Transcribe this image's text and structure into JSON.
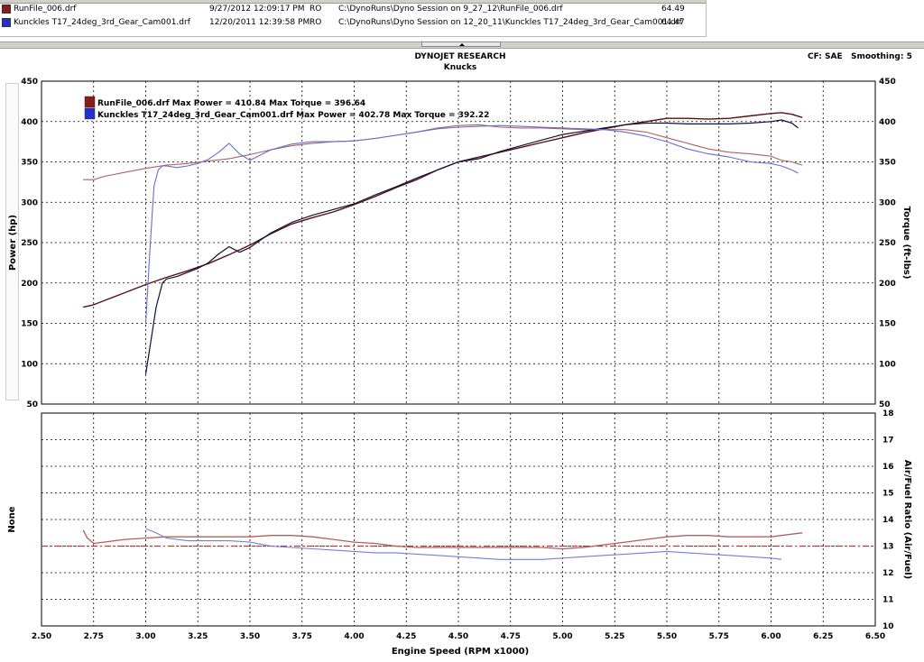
{
  "files": [
    {
      "name": "RunFile_006.drf",
      "date": "9/27/2012 12:09:17 PM",
      "type": "RO",
      "path": "C:\\DynoRuns\\Dyno Session on 9_27_12\\RunFile_006.drf",
      "value": "64.49",
      "color": "#8b1a1a"
    },
    {
      "name": "Kunckles T17_24deg_3rd_Gear_Cam001.drf",
      "date": "12/20/2011 12:39:58 PM",
      "type": "RO",
      "path": "C:\\DynoRuns\\Dyno Session on 12_20_11\\Kunckles T17_24deg_3rd_Gear_Cam001.drf",
      "value": "64.47",
      "color": "#2233cc"
    }
  ],
  "header": {
    "brand": "DYNOJET RESEARCH",
    "subtitle": "Knucks",
    "cf": "CF: SAE",
    "smoothing": "Smoothing: 5"
  },
  "chart_data": [
    {
      "type": "line",
      "title": "DYNOJET RESEARCH",
      "subtitle": "Knucks",
      "xlabel": "Engine Speed (RPM x1000)",
      "ylabel": "Power (hp)",
      "y2label": "Torque (ft-lbs)",
      "xlim": [
        2.5,
        6.5
      ],
      "ylim": [
        50,
        450
      ],
      "y2lim": [
        50,
        450
      ],
      "xticks": [
        "2.50",
        "2.75",
        "3.00",
        "3.25",
        "3.50",
        "3.75",
        "4.00",
        "4.25",
        "4.50",
        "4.75",
        "5.00",
        "5.25",
        "5.50",
        "5.75",
        "6.00",
        "6.25",
        "6.50"
      ],
      "yticks": [
        "50",
        "100",
        "150",
        "200",
        "250",
        "300",
        "350",
        "400",
        "450"
      ],
      "grid": true,
      "legend_position": "top-left",
      "legend": [
        {
          "text": "RunFile_006.drf Max Power = 410.84 Max Torque = 396.64",
          "color": "#8b1a1a"
        },
        {
          "text": "Kunckles T17_24deg_3rd_Gear_Cam001.drf Max Power = 402.78 Max Torque = 392.22",
          "color": "#2233cc"
        }
      ],
      "series": [
        {
          "name": "RunFile_006.drf Power",
          "axis": "left",
          "color": "#5a1010",
          "width": 1.4,
          "x": [
            2.7,
            2.75,
            2.8,
            2.9,
            3.0,
            3.1,
            3.2,
            3.3,
            3.4,
            3.5,
            3.6,
            3.7,
            3.8,
            3.9,
            4.0,
            4.1,
            4.2,
            4.3,
            4.4,
            4.5,
            4.6,
            4.7,
            4.8,
            4.9,
            5.0,
            5.1,
            5.2,
            5.3,
            5.4,
            5.5,
            5.6,
            5.7,
            5.8,
            5.9,
            6.0,
            6.05,
            6.1,
            6.15
          ],
          "y": [
            170,
            173,
            178,
            188,
            198,
            207,
            215,
            224,
            235,
            247,
            261,
            273,
            281,
            288,
            297,
            307,
            318,
            328,
            340,
            350,
            356,
            362,
            368,
            374,
            380,
            386,
            391,
            396,
            400,
            404,
            404,
            403,
            404,
            407,
            410,
            411,
            409,
            405
          ]
        },
        {
          "name": "RunFile_006.drf Torque",
          "axis": "right",
          "color": "#b06060",
          "width": 1.1,
          "x": [
            2.7,
            2.75,
            2.8,
            2.9,
            3.0,
            3.1,
            3.2,
            3.3,
            3.4,
            3.5,
            3.6,
            3.7,
            3.8,
            3.9,
            4.0,
            4.1,
            4.2,
            4.3,
            4.4,
            4.5,
            4.6,
            4.7,
            4.8,
            4.9,
            5.0,
            5.1,
            5.2,
            5.3,
            5.4,
            5.5,
            5.6,
            5.7,
            5.8,
            5.9,
            6.0,
            6.05,
            6.1,
            6.15
          ],
          "y": [
            328,
            328,
            332,
            337,
            342,
            346,
            348,
            351,
            354,
            359,
            365,
            370,
            373,
            375,
            376,
            379,
            383,
            387,
            392,
            395,
            396,
            393,
            392,
            392,
            391,
            390,
            390,
            390,
            387,
            380,
            373,
            366,
            362,
            360,
            357,
            352,
            350,
            346
          ]
        },
        {
          "name": "Kunckles Power",
          "axis": "left",
          "color": "#101040",
          "width": 1.2,
          "x": [
            3.0,
            3.02,
            3.05,
            3.08,
            3.1,
            3.15,
            3.2,
            3.25,
            3.3,
            3.35,
            3.4,
            3.45,
            3.5,
            3.6,
            3.7,
            3.8,
            3.9,
            4.0,
            4.1,
            4.2,
            4.3,
            4.4,
            4.5,
            4.6,
            4.7,
            4.8,
            4.9,
            5.0,
            5.1,
            5.2,
            5.3,
            5.4,
            5.5,
            5.6,
            5.7,
            5.8,
            5.9,
            6.0,
            6.05,
            6.1,
            6.13
          ],
          "y": [
            87,
            120,
            170,
            200,
            205,
            208,
            213,
            218,
            225,
            236,
            245,
            238,
            244,
            262,
            275,
            284,
            291,
            298,
            309,
            319,
            330,
            340,
            350,
            354,
            363,
            370,
            377,
            384,
            388,
            392,
            396,
            398,
            398,
            397,
            397,
            397,
            398,
            400,
            402,
            398,
            392
          ]
        },
        {
          "name": "Kunckles Torque",
          "axis": "right",
          "color": "#6070d0",
          "width": 1.1,
          "x": [
            3.0,
            3.02,
            3.04,
            3.06,
            3.08,
            3.1,
            3.15,
            3.2,
            3.25,
            3.3,
            3.35,
            3.4,
            3.45,
            3.5,
            3.6,
            3.7,
            3.8,
            3.9,
            4.0,
            4.1,
            4.2,
            4.3,
            4.4,
            4.5,
            4.6,
            4.7,
            4.8,
            4.9,
            5.0,
            5.1,
            5.2,
            5.3,
            5.4,
            5.5,
            5.6,
            5.7,
            5.8,
            5.9,
            6.0,
            6.05,
            6.1,
            6.13
          ],
          "y": [
            150,
            240,
            320,
            340,
            345,
            345,
            343,
            345,
            348,
            353,
            362,
            373,
            360,
            352,
            365,
            372,
            375,
            375,
            376,
            379,
            383,
            387,
            391,
            393,
            394,
            395,
            394,
            393,
            392,
            391,
            390,
            387,
            382,
            375,
            366,
            360,
            356,
            350,
            348,
            345,
            340,
            336
          ]
        }
      ]
    },
    {
      "type": "line",
      "xlabel": "Engine Speed (RPM x1000)",
      "ylabel": "None",
      "y2label": "Air/Fuel Ratio (Air/Fuel)",
      "xlim": [
        2.5,
        6.5
      ],
      "y2lim": [
        10,
        18
      ],
      "y2ticks": [
        "10",
        "11",
        "12",
        "13",
        "14",
        "15",
        "16",
        "17",
        "18"
      ],
      "grid": true,
      "reference_line": {
        "y": 13,
        "color": "#cc3333",
        "style": "dash-dot"
      },
      "series": [
        {
          "name": "RunFile_006.drf AFR",
          "axis": "right",
          "color": "#b06060",
          "width": 1.3,
          "x": [
            2.7,
            2.72,
            2.75,
            2.8,
            2.9,
            3.0,
            3.1,
            3.2,
            3.3,
            3.4,
            3.5,
            3.6,
            3.7,
            3.8,
            3.9,
            4.0,
            4.1,
            4.2,
            4.3,
            4.4,
            4.5,
            4.6,
            4.7,
            4.8,
            4.9,
            5.0,
            5.1,
            5.2,
            5.3,
            5.4,
            5.5,
            5.6,
            5.7,
            5.8,
            5.9,
            6.0,
            6.1,
            6.15
          ],
          "y": [
            13.6,
            13.3,
            13.1,
            13.15,
            13.25,
            13.3,
            13.35,
            13.35,
            13.35,
            13.35,
            13.35,
            13.4,
            13.4,
            13.35,
            13.25,
            13.15,
            13.1,
            13.0,
            12.95,
            12.95,
            12.95,
            12.95,
            12.95,
            12.95,
            12.95,
            12.9,
            12.95,
            13.05,
            13.15,
            13.25,
            13.35,
            13.4,
            13.4,
            13.35,
            13.35,
            13.35,
            13.45,
            13.5
          ]
        },
        {
          "name": "Kunckles AFR",
          "axis": "right",
          "color": "#7080d8",
          "width": 1.1,
          "x": [
            3.0,
            3.05,
            3.1,
            3.2,
            3.3,
            3.4,
            3.5,
            3.6,
            3.7,
            3.8,
            3.9,
            4.0,
            4.1,
            4.2,
            4.3,
            4.4,
            4.5,
            4.6,
            4.7,
            4.8,
            4.9,
            5.0,
            5.1,
            5.2,
            5.3,
            5.4,
            5.5,
            5.6,
            5.7,
            5.8,
            5.9,
            6.0,
            6.05
          ],
          "y": [
            13.65,
            13.5,
            13.3,
            13.2,
            13.2,
            13.2,
            13.15,
            13.0,
            12.95,
            12.9,
            12.85,
            12.8,
            12.75,
            12.75,
            12.7,
            12.65,
            12.6,
            12.55,
            12.5,
            12.5,
            12.5,
            12.55,
            12.6,
            12.65,
            12.7,
            12.75,
            12.8,
            12.75,
            12.7,
            12.65,
            12.6,
            12.55,
            12.5
          ]
        }
      ]
    }
  ]
}
